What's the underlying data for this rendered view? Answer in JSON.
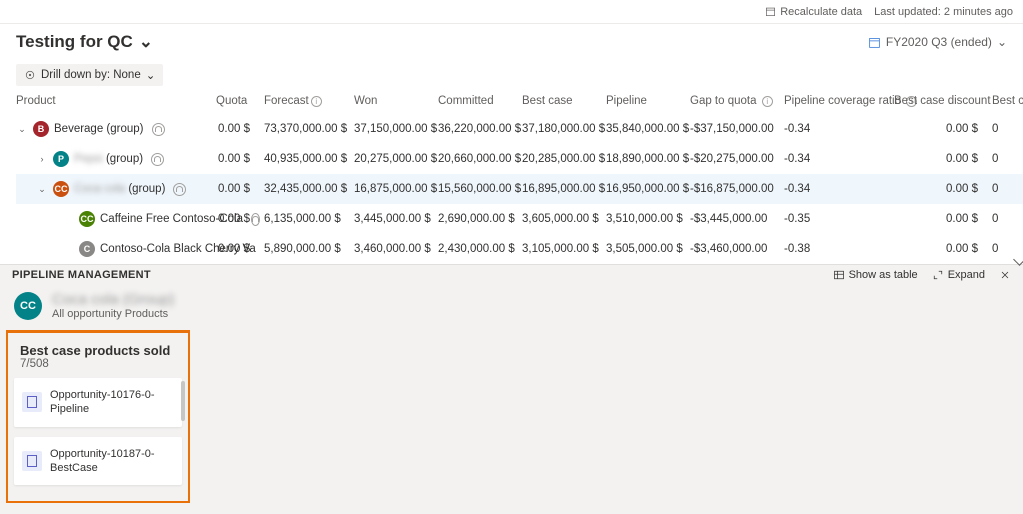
{
  "topbar": {
    "recalc": "Recalculate data",
    "updated": "Last updated: 2 minutes ago"
  },
  "header": {
    "title": "Testing for QC",
    "period": "FY2020 Q3 (ended)"
  },
  "drill": {
    "label": "Drill down by: None"
  },
  "cols": {
    "product": "Product",
    "quota": "Quota",
    "forecast": "Forecast",
    "won": "Won",
    "committed": "Committed",
    "bestcase": "Best case",
    "pipeline": "Pipeline",
    "gap": "Gap to quota",
    "ratio": "Pipeline coverage ratio",
    "discount": "Best case discount",
    "prod": "Best case prod..."
  },
  "rows": [
    {
      "exp": "⌄",
      "ind": 0,
      "bc": "b-red",
      "bl": "B",
      "name": "Beverage (group)",
      "usr": true,
      "quota": "0.00 $",
      "forecast": "73,370,000.00 $",
      "won": "37,150,000.00 $",
      "committed": "36,220,000.00 $",
      "bestcase": "37,180,000.00 $",
      "pipeline": "35,840,000.00 $",
      "gap": "-$37,150,000.00",
      "ratio": "-0.34",
      "discount": "0.00 $",
      "prod": "0"
    },
    {
      "exp": "›",
      "ind": 1,
      "bc": "b-teal",
      "bl": "P",
      "name": "Pepsi (group)",
      "blur": true,
      "usr": true,
      "quota": "0.00 $",
      "forecast": "40,935,000.00 $",
      "won": "20,275,000.00 $",
      "committed": "20,660,000.00 $",
      "bestcase": "20,285,000.00 $",
      "pipeline": "18,890,000.00 $",
      "gap": "-$20,275,000.00",
      "ratio": "-0.34",
      "discount": "0.00 $",
      "prod": "0"
    },
    {
      "hl": true,
      "exp": "⌄",
      "ind": 1,
      "bc": "b-dred",
      "bl": "CC",
      "name": "Coca cola (group)",
      "blur": true,
      "usr": true,
      "quota": "0.00 $",
      "forecast": "32,435,000.00 $",
      "won": "16,875,000.00 $",
      "committed": "15,560,000.00 $",
      "bestcase": "16,895,000.00 $",
      "pipeline": "16,950,000.00 $",
      "gap": "-$16,875,000.00",
      "ratio": "-0.34",
      "discount": "0.00 $",
      "prod": "0"
    },
    {
      "exp": "",
      "ind": 3,
      "bc": "b-green",
      "bl": "CC",
      "name": "Caffeine Free Contoso-Cola",
      "usr": true,
      "quota": "0.00 $",
      "forecast": "6,135,000.00 $",
      "won": "3,445,000.00 $",
      "committed": "2,690,000.00 $",
      "bestcase": "3,605,000.00 $",
      "pipeline": "3,510,000.00 $",
      "gap": "-$3,445,000.00",
      "ratio": "-0.35",
      "discount": "0.00 $",
      "prod": "0"
    },
    {
      "exp": "",
      "ind": 3,
      "bc": "b-gray",
      "bl": "C",
      "name": "Contoso-Cola Black Cherry Va",
      "usr": false,
      "quota": "0.00 $",
      "forecast": "5,890,000.00 $",
      "won": "3,460,000.00 $",
      "committed": "2,430,000.00 $",
      "bestcase": "3,105,000.00 $",
      "pipeline": "3,505,000.00 $",
      "gap": "-$3,460,000.00",
      "ratio": "-0.38",
      "discount": "0.00 $",
      "prod": "0"
    }
  ],
  "panel": {
    "title": "PIPELINE MANAGEMENT",
    "showTable": "Show as table",
    "expand": "Expand",
    "groupName": "Coca cola (Group)",
    "groupSub": "All opportunity Products",
    "cardTitle": "Best case products sold",
    "cardCount": "7/508",
    "cards": [
      "Opportunity-10176-0-Pipeline",
      "Opportunity-10187-0-BestCase"
    ]
  }
}
